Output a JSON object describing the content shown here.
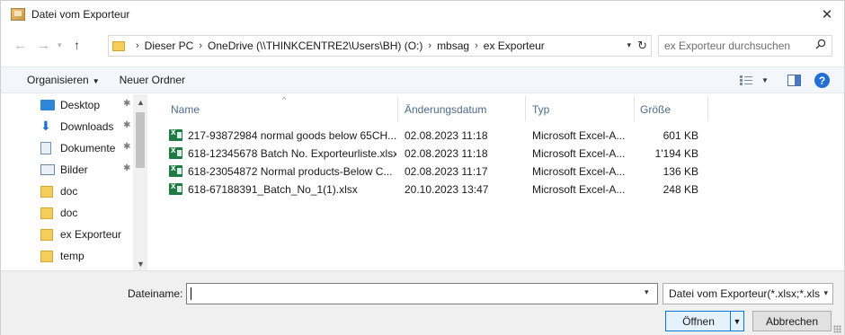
{
  "window": {
    "title": "Datei vom Exporteur"
  },
  "nav": {
    "back_icon": "arrow-left-icon",
    "forward_icon": "arrow-right-icon",
    "up_icon": "arrow-up-icon",
    "breadcrumbs": [
      "Dieser PC",
      "OneDrive (\\\\THINKCENTRE2\\Users\\BH) (O:)",
      "mbsag",
      "ex Exporteur"
    ],
    "search_placeholder": "ex Exporteur durchsuchen"
  },
  "toolbar": {
    "organize_label": "Organisieren",
    "new_folder_label": "Neuer Ordner"
  },
  "sidebar": {
    "items": [
      {
        "label": "Desktop",
        "icon": "desktop-icon",
        "pinned": true
      },
      {
        "label": "Downloads",
        "icon": "download-icon",
        "pinned": true
      },
      {
        "label": "Dokumente",
        "icon": "document-icon",
        "pinned": true
      },
      {
        "label": "Bilder",
        "icon": "pictures-icon",
        "pinned": true
      },
      {
        "label": "doc",
        "icon": "folder-icon",
        "pinned": false
      },
      {
        "label": "doc",
        "icon": "folder-icon",
        "pinned": false
      },
      {
        "label": "ex Exporteur",
        "icon": "folder-icon",
        "pinned": false
      },
      {
        "label": "temp",
        "icon": "folder-icon",
        "pinned": false
      }
    ]
  },
  "filelist": {
    "columns": {
      "name": "Name",
      "date": "Änderungsdatum",
      "type": "Typ",
      "size": "Größe"
    },
    "rows": [
      {
        "name": "217-93872984 normal goods below 65CH...",
        "date": "02.08.2023 11:18",
        "type": "Microsoft Excel-A...",
        "size": "601 KB"
      },
      {
        "name": "618-12345678 Batch No. Exporteurliste.xlsx",
        "date": "02.08.2023 11:18",
        "type": "Microsoft Excel-A...",
        "size": "1'194 KB"
      },
      {
        "name": "618-23054872 Normal products-Below C...",
        "date": "02.08.2023 11:17",
        "type": "Microsoft Excel-A...",
        "size": "136 KB"
      },
      {
        "name": "618-67188391_Batch_No_1(1).xlsx",
        "date": "20.10.2023 13:47",
        "type": "Microsoft Excel-A...",
        "size": "248 KB"
      }
    ]
  },
  "bottom": {
    "filename_label": "Dateiname:",
    "filename_value": "",
    "filetype_selected": "Datei vom Exporteur(*.xlsx;*.xls",
    "open_label": "Öffnen",
    "cancel_label": "Abbrechen"
  },
  "colors": {
    "accent": "#0078d7",
    "folder": "#f6cc5a",
    "excel": "#1d7a43",
    "toolbar_bg": "#f3f6fb"
  }
}
